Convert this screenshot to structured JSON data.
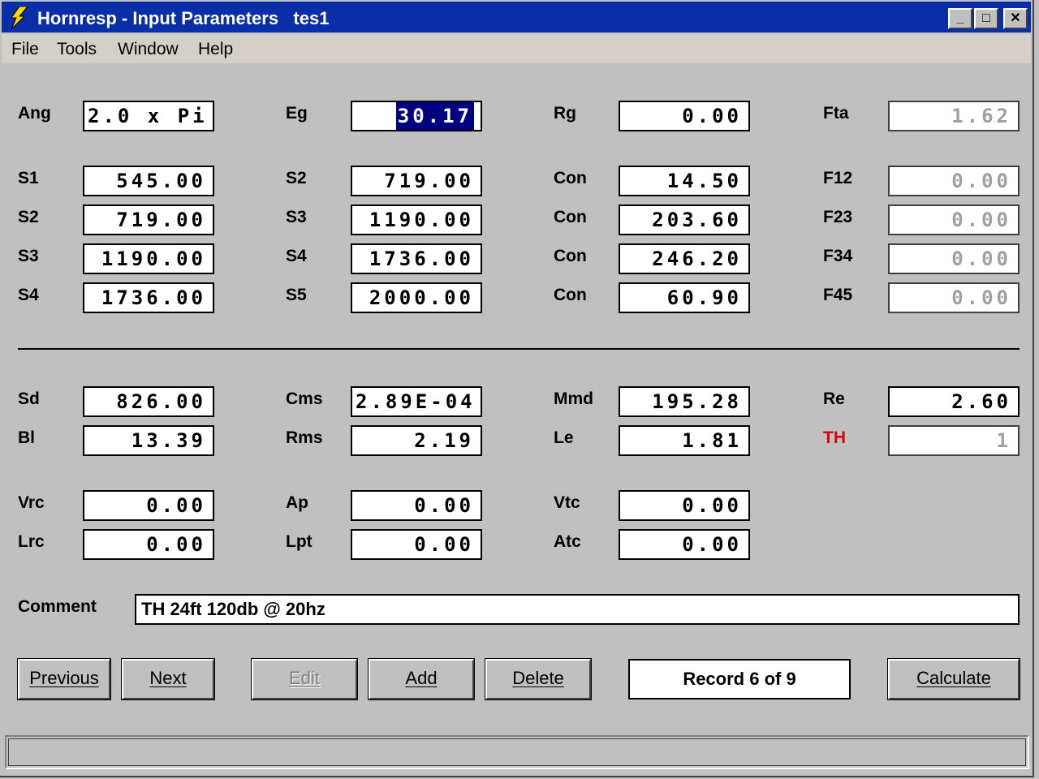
{
  "window": {
    "title": "Hornresp - Input Parameters   tes1",
    "minimize": "_",
    "maximize": "□",
    "close": "✕"
  },
  "menu": [
    "File",
    "Tools",
    "Window",
    "Help"
  ],
  "row1": {
    "ang": {
      "label": "Ang",
      "value": "2.0 x Pi"
    },
    "eg": {
      "label": "Eg",
      "value": "30.17"
    },
    "rg": {
      "label": "Rg",
      "value": "0.00"
    },
    "fta": {
      "label": "Fta",
      "value": "1.62"
    }
  },
  "segments": [
    {
      "sa_label": "S1",
      "sa_value": "545.00",
      "sb_label": "S2",
      "sb_value": "719.00",
      "con_label": "Con",
      "con_value": "14.50",
      "f_label": "F12",
      "f_value": "0.00"
    },
    {
      "sa_label": "S2",
      "sa_value": "719.00",
      "sb_label": "S3",
      "sb_value": "1190.00",
      "con_label": "Con",
      "con_value": "203.60",
      "f_label": "F23",
      "f_value": "0.00"
    },
    {
      "sa_label": "S3",
      "sa_value": "1190.00",
      "sb_label": "S4",
      "sb_value": "1736.00",
      "con_label": "Con",
      "con_value": "246.20",
      "f_label": "F34",
      "f_value": "0.00"
    },
    {
      "sa_label": "S4",
      "sa_value": "1736.00",
      "sb_label": "S5",
      "sb_value": "2000.00",
      "con_label": "Con",
      "con_value": "60.90",
      "f_label": "F45",
      "f_value": "0.00"
    }
  ],
  "driver": {
    "sd": {
      "label": "Sd",
      "value": "826.00"
    },
    "cms": {
      "label": "Cms",
      "value": "2.89E-04"
    },
    "mmd": {
      "label": "Mmd",
      "value": "195.28"
    },
    "re": {
      "label": "Re",
      "value": "2.60"
    },
    "bl": {
      "label": "Bl",
      "value": "13.39"
    },
    "rms": {
      "label": "Rms",
      "value": "2.19"
    },
    "le": {
      "label": "Le",
      "value": "1.81"
    },
    "th": {
      "label": "TH",
      "value": "1"
    }
  },
  "chambers": {
    "vrc": {
      "label": "Vrc",
      "value": "0.00"
    },
    "ap": {
      "label": "Ap",
      "value": "0.00"
    },
    "vtc": {
      "label": "Vtc",
      "value": "0.00"
    },
    "lrc": {
      "label": "Lrc",
      "value": "0.00"
    },
    "lpt": {
      "label": "Lpt",
      "value": "0.00"
    },
    "atc": {
      "label": "Atc",
      "value": "0.00"
    }
  },
  "comment": {
    "label": "Comment",
    "value": "TH 24ft 120db @ 20hz"
  },
  "buttons": {
    "previous": "Previous",
    "next": "Next",
    "edit": "Edit",
    "add": "Add",
    "delete": "Delete",
    "calculate": "Calculate"
  },
  "record": "Record 6 of 9",
  "colors": {
    "titlebar": "#0a2ea8",
    "highlight": "#000080",
    "th_label": "#e00000"
  }
}
